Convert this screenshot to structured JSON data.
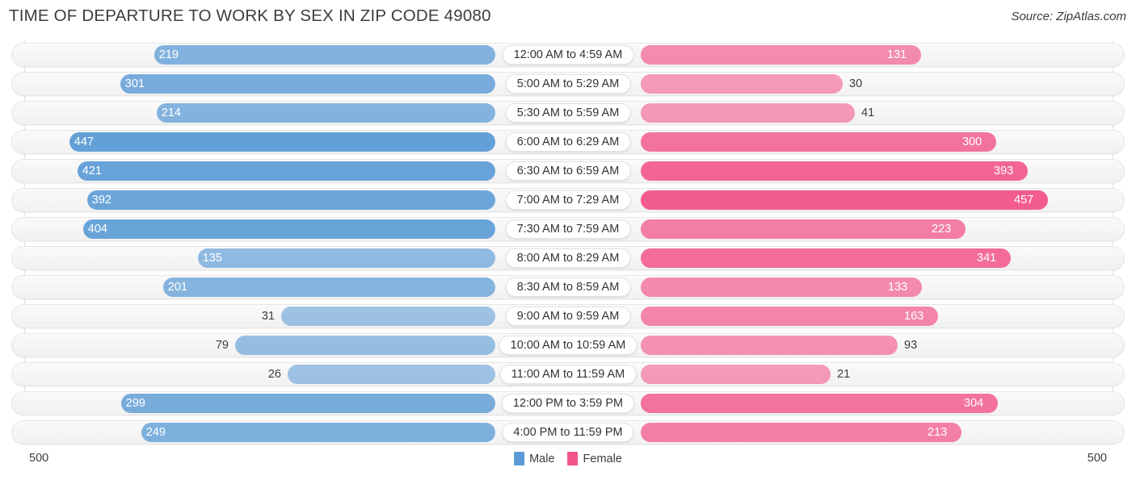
{
  "header": {
    "title": "TIME OF DEPARTURE TO WORK BY SEX IN ZIP CODE 49080",
    "source": "Source: ZipAtlas.com"
  },
  "axis": {
    "left_label": "500",
    "right_label": "500"
  },
  "legend": {
    "items": [
      {
        "label": "Male",
        "color": "#5b9bd5"
      },
      {
        "label": "Female",
        "color": "#f2558a"
      }
    ]
  },
  "colors": {
    "male": "#5b9bd5",
    "female": "#f2558a",
    "track": "#f4f4f4",
    "gridline": "#e2e2e2",
    "text": "#3c3c3c"
  },
  "chart_data": {
    "type": "bar",
    "orientation": "horizontal",
    "style": "diverging-bidirectional",
    "title": "TIME OF DEPARTURE TO WORK BY SEX IN ZIP CODE 49080",
    "xlabel": "",
    "ylabel": "",
    "xlim": [
      -500,
      500
    ],
    "axis_extent": 500,
    "grid": true,
    "legend_position": "bottom-center",
    "categories": [
      "12:00 AM to 4:59 AM",
      "5:00 AM to 5:29 AM",
      "5:30 AM to 5:59 AM",
      "6:00 AM to 6:29 AM",
      "6:30 AM to 6:59 AM",
      "7:00 AM to 7:29 AM",
      "7:30 AM to 7:59 AM",
      "8:00 AM to 8:29 AM",
      "8:30 AM to 8:59 AM",
      "9:00 AM to 9:59 AM",
      "10:00 AM to 10:59 AM",
      "11:00 AM to 11:59 AM",
      "12:00 PM to 3:59 PM",
      "4:00 PM to 11:59 PM"
    ],
    "series": [
      {
        "name": "Male",
        "color": "#5b9bd5",
        "direction": "left",
        "values": [
          219,
          301,
          214,
          447,
          421,
          392,
          404,
          135,
          201,
          31,
          79,
          26,
          299,
          249
        ]
      },
      {
        "name": "Female",
        "color": "#f2558a",
        "direction": "right",
        "values": [
          131,
          30,
          41,
          300,
          393,
          457,
          223,
          341,
          133,
          163,
          93,
          21,
          304,
          213
        ]
      }
    ]
  }
}
